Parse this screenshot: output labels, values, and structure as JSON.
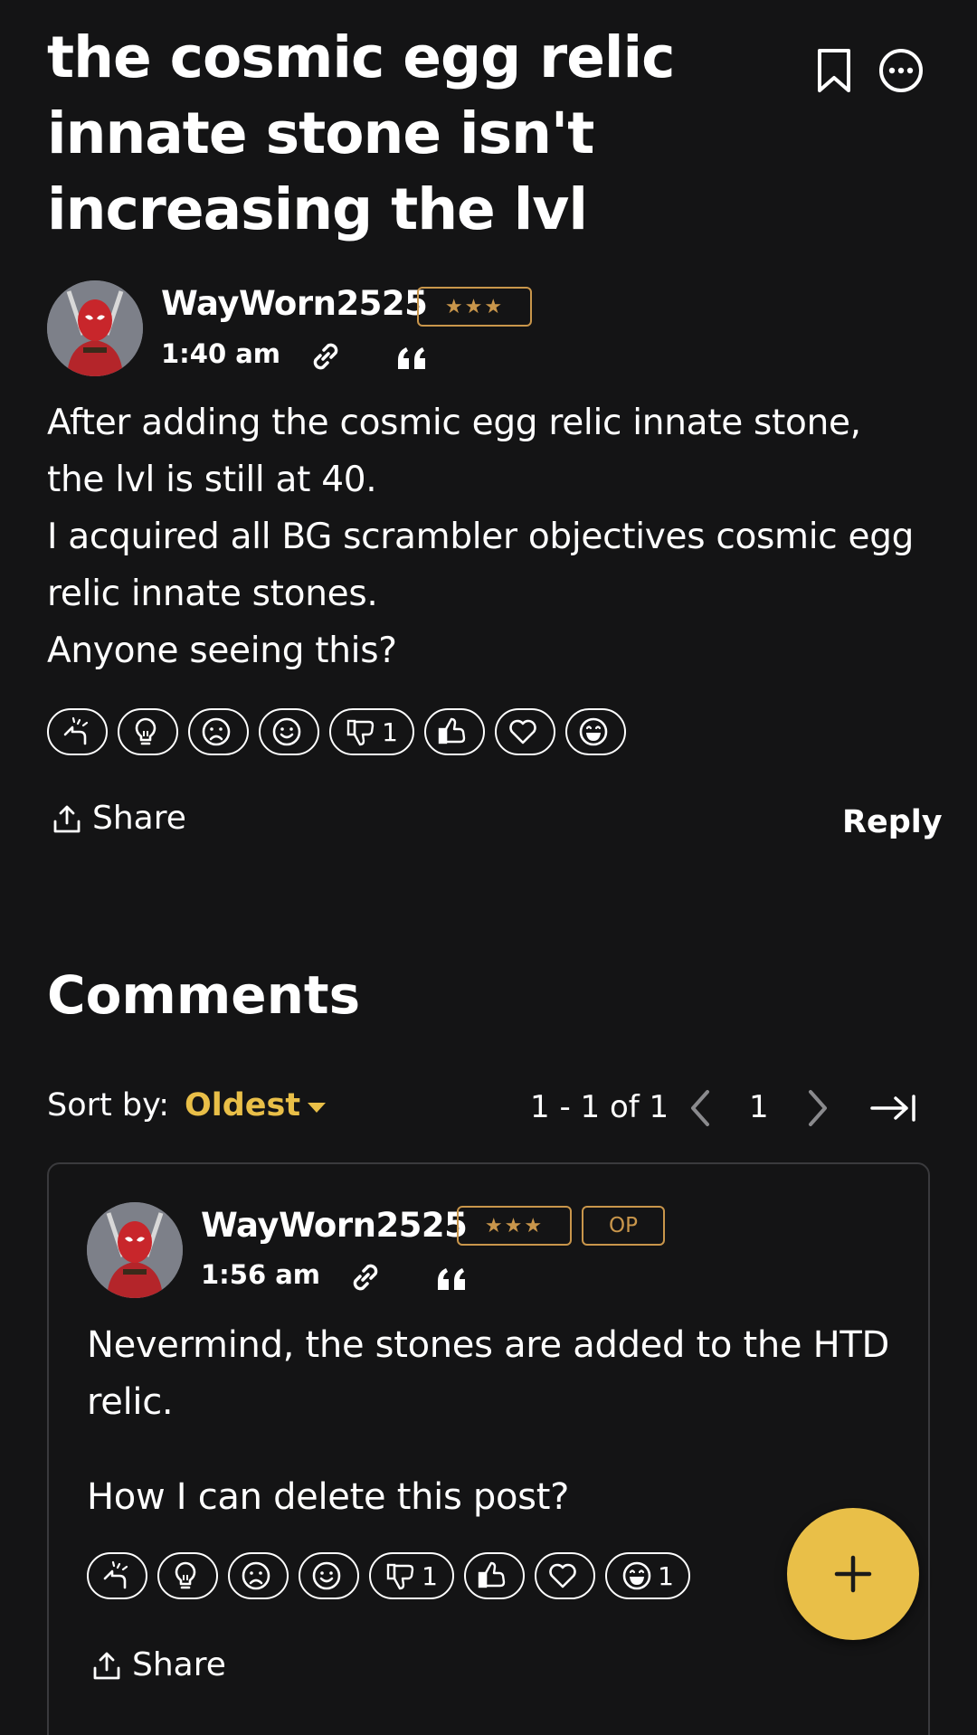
{
  "post": {
    "title": "the cosmic egg relic innate stone isn't increasing the lvl",
    "author": "WayWorn2525",
    "rank": "★★★",
    "time": "1:40 am",
    "body_lines": [
      "After adding the cosmic egg relic innate stone,",
      "the lvl is still at 40.",
      "I acquired all BG scrambler objectives cosmic egg",
      "relic innate stones.",
      "Anyone seeing this?"
    ],
    "reactions": [
      {
        "icon": "oops-icon",
        "count": ""
      },
      {
        "icon": "lightbulb-icon",
        "count": ""
      },
      {
        "icon": "sad-face-icon",
        "count": ""
      },
      {
        "icon": "smile-face-icon",
        "count": ""
      },
      {
        "icon": "thumbs-down-icon",
        "count": "1"
      },
      {
        "icon": "thumbs-up-icon",
        "count": ""
      },
      {
        "icon": "heart-icon",
        "count": ""
      },
      {
        "icon": "laugh-face-icon",
        "count": ""
      }
    ],
    "share_label": "Share",
    "reply_label": "Reply"
  },
  "comments": {
    "heading": "Comments",
    "sort_label": "Sort by:",
    "sort_value": "Oldest",
    "range": "1 - 1 of 1",
    "page": "1"
  },
  "comment": {
    "author": "WayWorn2525",
    "rank": "★★★",
    "op_badge": "OP",
    "time": "1:56 am",
    "paragraph1_lines": [
      "Nevermind, the stones are added to the HTD",
      "relic."
    ],
    "paragraph2": "How I can delete this post?",
    "reactions": [
      {
        "icon": "oops-icon",
        "count": ""
      },
      {
        "icon": "lightbulb-icon",
        "count": ""
      },
      {
        "icon": "sad-face-icon",
        "count": ""
      },
      {
        "icon": "smile-face-icon",
        "count": ""
      },
      {
        "icon": "thumbs-down-icon",
        "count": "1"
      },
      {
        "icon": "thumbs-up-icon",
        "count": ""
      },
      {
        "icon": "heart-icon",
        "count": ""
      },
      {
        "icon": "laugh-face-icon",
        "count": "1"
      }
    ],
    "share_label": "Share"
  },
  "colors": {
    "background": "#141415",
    "accent": "#e9bf48",
    "rank_gold": "#c9964b",
    "text": "#ffffff"
  }
}
